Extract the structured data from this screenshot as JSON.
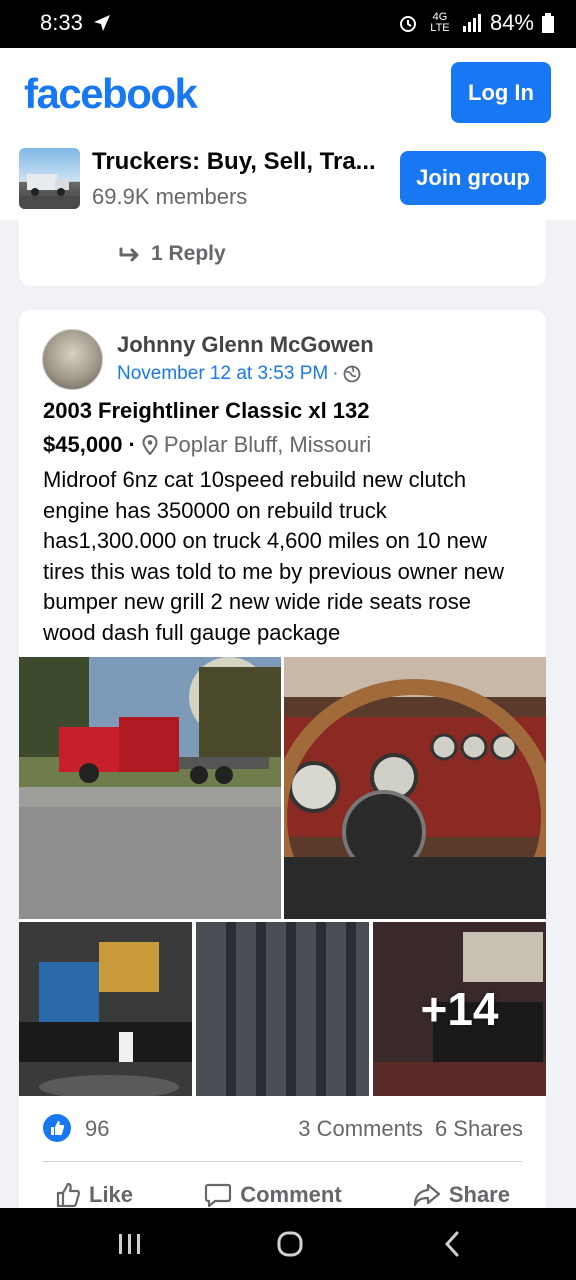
{
  "status_bar": {
    "time": "8:33",
    "network": "4G LTE",
    "battery": "84%"
  },
  "header": {
    "logo": "facebook",
    "login_label": "Log In"
  },
  "group": {
    "name": "Truckers: Buy, Sell, Tra...",
    "members": "69.9K members",
    "join_label": "Join group"
  },
  "previous_card": {
    "reply_label": "1 Reply"
  },
  "post": {
    "author": "Johnny Glenn McGowen",
    "timestamp": "November 12 at 3:53 PM",
    "privacy_icon": "globe-icon",
    "title": "2003 Freightliner Classic xl 132",
    "price": "$45,000",
    "location": "Poplar Bluff, Missouri",
    "description": "Midroof 6nz cat 10speed rebuild new clutch engine has 350000 on rebuild truck has1,300.000 on truck 4,600 miles on 10 new tires this was told to me by previous owner new bumper new grill 2 new wide ride seats rose wood dash full gauge package",
    "more_photos": "+14",
    "likes": "96",
    "comments": "3 Comments",
    "shares": "6 Shares",
    "actions": {
      "like": "Like",
      "comment": "Comment",
      "share": "Share"
    }
  },
  "colors": {
    "brand": "#1877f2",
    "secondary_text": "#65676b",
    "background": "#f0f2f5"
  }
}
